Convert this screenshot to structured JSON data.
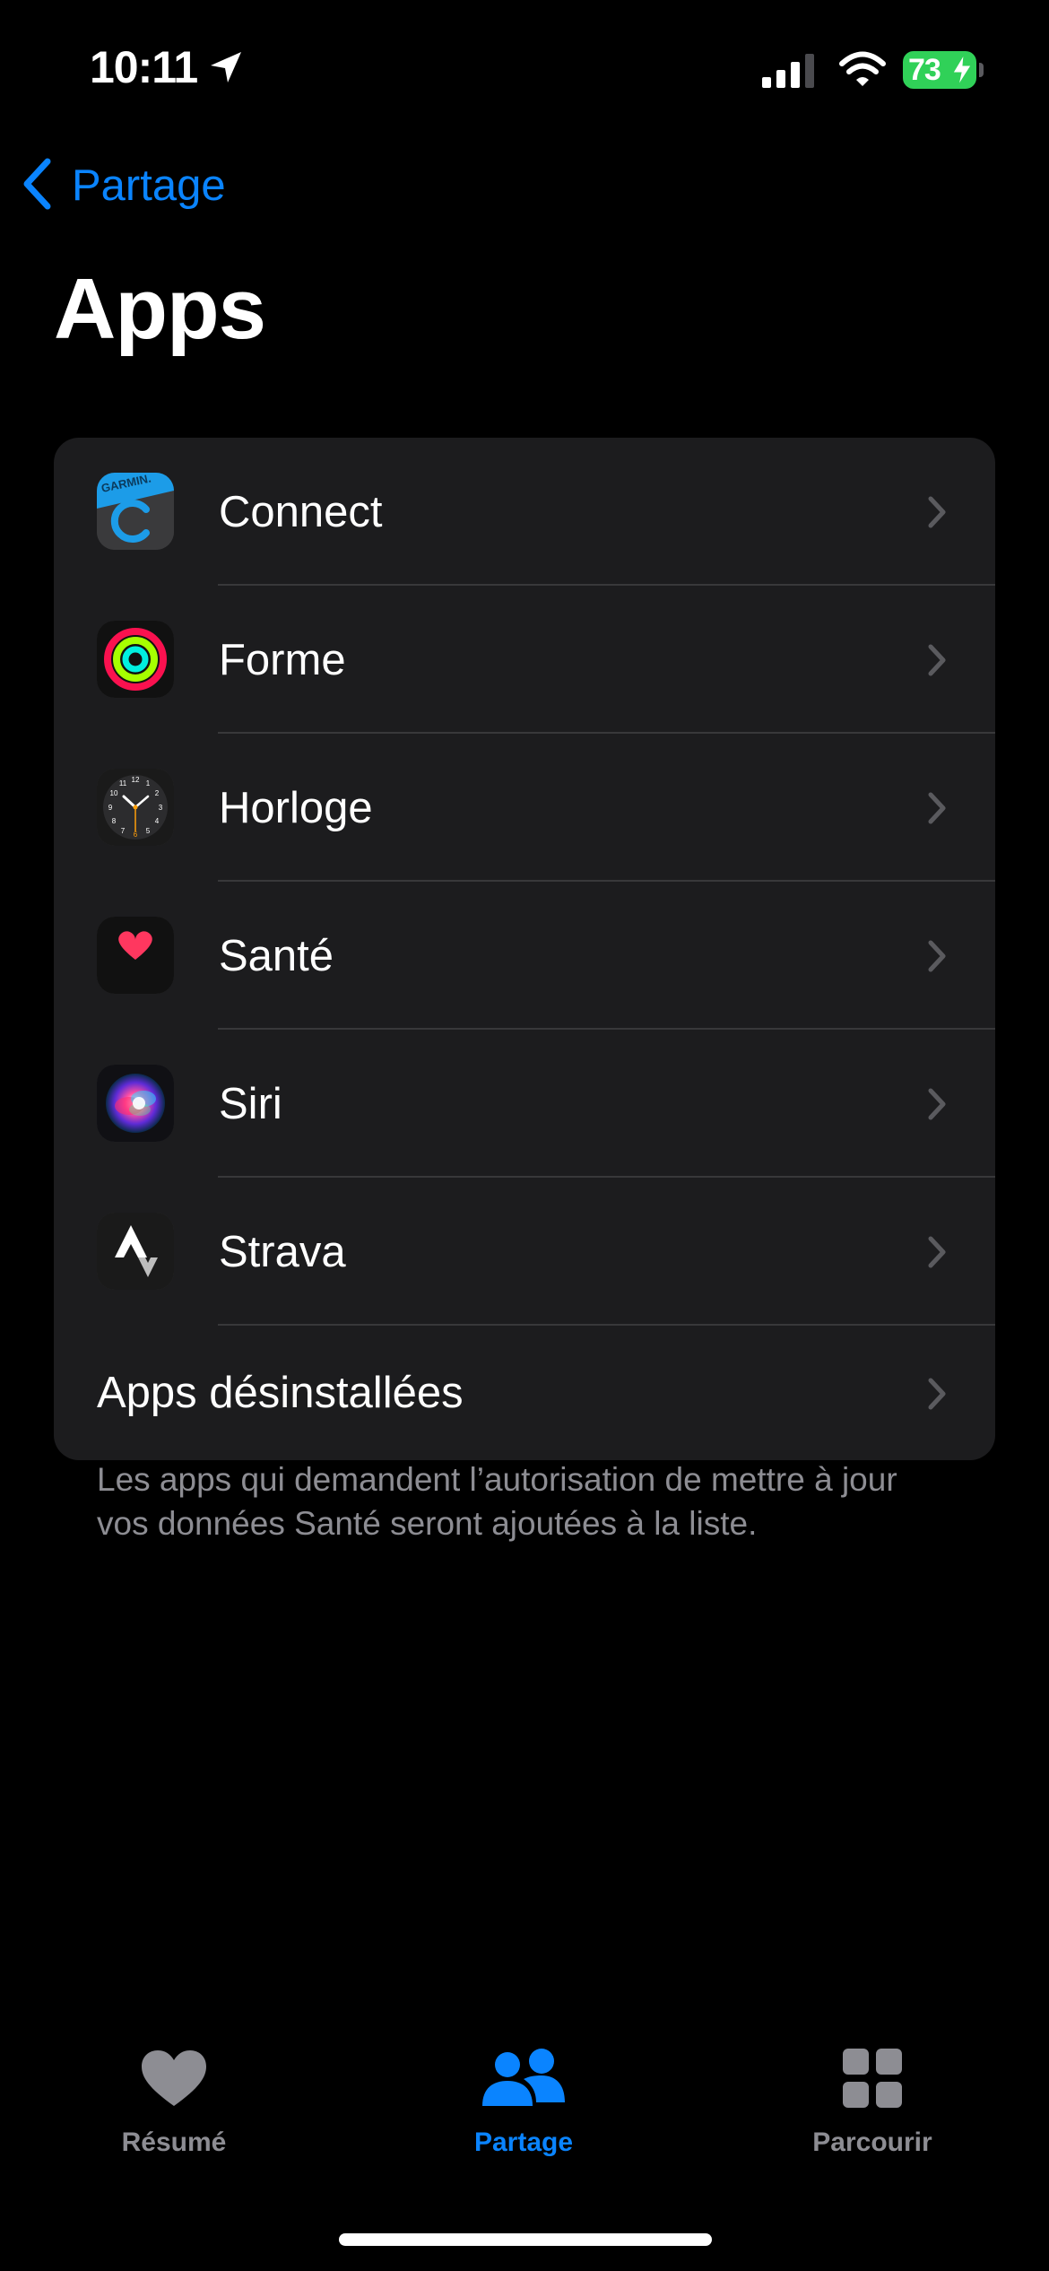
{
  "status_bar": {
    "time": "10:11",
    "battery_level": "73",
    "battery_charging": true,
    "signal_bars": "3 of 4",
    "icons": [
      "location-arrow-icon",
      "cellular-signal-icon",
      "wifi-icon",
      "battery-icon",
      "charging-bolt-icon"
    ]
  },
  "nav": {
    "back_label": "Partage",
    "title": "Apps"
  },
  "apps": [
    {
      "label": "Connect",
      "icon": "garmin-connect-app-icon"
    },
    {
      "label": "Forme",
      "icon": "fitness-rings-app-icon"
    },
    {
      "label": "Horloge",
      "icon": "clock-app-icon"
    },
    {
      "label": "Santé",
      "icon": "health-heart-app-icon"
    },
    {
      "label": "Siri",
      "icon": "siri-app-icon"
    },
    {
      "label": "Strava",
      "icon": "strava-app-icon"
    }
  ],
  "uninstalled_apps_label": "Apps désinstallées",
  "footer_note": "Les apps qui demandent l’autorisation de mettre à jour vos données Santé seront ajoutées à la liste.",
  "tab_bar": {
    "tabs": [
      {
        "label": "Résumé",
        "icon": "heart-icon",
        "selected": false
      },
      {
        "label": "Partage",
        "icon": "people-icon",
        "selected": true
      },
      {
        "label": "Parcourir",
        "icon": "grid-icon",
        "selected": false
      }
    ]
  },
  "colors": {
    "accent": "#0a84ff",
    "background": "#000000",
    "card": "#1c1c1e",
    "separator": "#38383a",
    "secondary_text": "#8d8d93",
    "battery": "#30d158"
  }
}
